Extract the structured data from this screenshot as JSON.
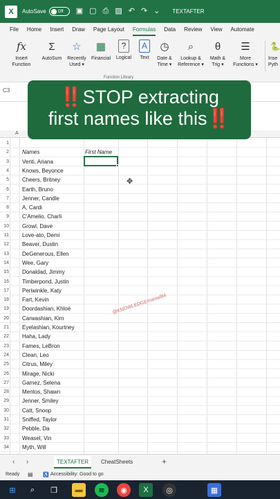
{
  "titlebar": {
    "logo": "X",
    "autosave_label": "AutoSave",
    "toggle_label": "Off",
    "file_title": "TEXTAFTER",
    "icons": [
      "save-icon",
      "page-icon",
      "printer-icon",
      "image-icon",
      "undo-icon",
      "redo-icon",
      "dropdown-icon"
    ]
  },
  "ribbon_tabs": [
    "File",
    "Home",
    "Insert",
    "Draw",
    "Page Layout",
    "Formulas",
    "Data",
    "Review",
    "View",
    "Automate"
  ],
  "active_tab": "Formulas",
  "ribbon": {
    "insert_function": {
      "line1": "Insert",
      "line2": "Function",
      "icon": "fx"
    },
    "autosum": {
      "line1": "AutoSum",
      "line2": "",
      "icon": "Σ"
    },
    "recently_used": {
      "line1": "Recently",
      "line2": "Used ▾",
      "icon": "☆"
    },
    "financial": {
      "line1": "Financial",
      "line2": "",
      "icon": "▦"
    },
    "logical": {
      "line1": "Logical",
      "line2": "",
      "icon": "?"
    },
    "text": {
      "line1": "Text",
      "line2": "",
      "icon": "A"
    },
    "date_time": {
      "line1": "Date &",
      "line2": "Time ▾",
      "icon": "◷"
    },
    "lookup": {
      "line1": "Lookup &",
      "line2": "Reference ▾",
      "icon": "⌕"
    },
    "math": {
      "line1": "Math &",
      "line2": "Trig ▾",
      "icon": "θ"
    },
    "more": {
      "line1": "More",
      "line2": "Functions ▾",
      "icon": "☰"
    },
    "insert_python": {
      "line1": "Inse",
      "line2": "Pyth",
      "icon": "🐍"
    },
    "group_label": "Function Library"
  },
  "formula_bar": {
    "name_box": "C3"
  },
  "banner": {
    "line1_mark": "‼️",
    "line1": "STOP extracting",
    "line2": "first names like this",
    "line2_mark": "‼️"
  },
  "column_header_a": "A",
  "sheet": {
    "header_names": "Names",
    "header_first_name": "First Name",
    "rows": [
      {
        "num": "1",
        "name": ""
      },
      {
        "num": "2",
        "name": ""
      },
      {
        "num": "3",
        "name": "Venti, Ariana"
      },
      {
        "num": "4",
        "name": "Knows, Beyonce"
      },
      {
        "num": "5",
        "name": "Cheers, Britney"
      },
      {
        "num": "6",
        "name": "Earth, Bruno"
      },
      {
        "num": "7",
        "name": "Jenner, Candle"
      },
      {
        "num": "8",
        "name": "A, Cardi"
      },
      {
        "num": "9",
        "name": "C'Amelio, Charli"
      },
      {
        "num": "10",
        "name": "Growl, Dave"
      },
      {
        "num": "11",
        "name": "Love-ato, Demi"
      },
      {
        "num": "12",
        "name": "Beaver, Dustin"
      },
      {
        "num": "13",
        "name": "DeGenerous, Ellen"
      },
      {
        "num": "14",
        "name": "Wee, Gary"
      },
      {
        "num": "15",
        "name": "Donaldad, Jimmy"
      },
      {
        "num": "16",
        "name": "Timberpond, Justin"
      },
      {
        "num": "17",
        "name": "Periwinkle, Katy"
      },
      {
        "num": "18",
        "name": "Fart, Kevin"
      },
      {
        "num": "19",
        "name": "Doordashian, Khloé"
      },
      {
        "num": "20",
        "name": "Carwashian, Kim"
      },
      {
        "num": "21",
        "name": "Eyelashian, Kourtney"
      },
      {
        "num": "22",
        "name": "Haha, Lady"
      },
      {
        "num": "23",
        "name": "Fames, LeBron"
      },
      {
        "num": "24",
        "name": "Clean, Leo"
      },
      {
        "num": "25",
        "name": "Citrus, Miley"
      },
      {
        "num": "26",
        "name": "Mirage, Nicki"
      },
      {
        "num": "27",
        "name": "Gamez, Selena"
      },
      {
        "num": "28",
        "name": "Mentos, Shawn"
      },
      {
        "num": "29",
        "name": "Jenner, Smiley"
      },
      {
        "num": "30",
        "name": "Catt, Snoop"
      },
      {
        "num": "31",
        "name": "Sniffed, Taylor"
      },
      {
        "num": "32",
        "name": "Pebble, Da"
      },
      {
        "num": "33",
        "name": "Weasel, Vin"
      },
      {
        "num": "34",
        "name": "Myth, Will"
      }
    ]
  },
  "watermark": "@KNOWLEDGEmania9t4",
  "sheet_tabs": {
    "prev": "‹",
    "next": "›",
    "tab1": "TEXTAFTER",
    "tab2": "CheatSheets",
    "add": "+"
  },
  "status": {
    "ready": "Ready",
    "accessibility": "Accessibility: Good to go"
  },
  "taskbar_icons": [
    "windows-icon",
    "search-icon",
    "task-view-icon",
    "file-explorer-icon",
    "spotify-icon",
    "chrome-icon",
    "excel-icon",
    "obs-icon",
    "calculator-icon"
  ],
  "colors": {
    "excel_green": "#217346",
    "banner_green": "#1f6b3d",
    "taskbar": "#1a2330",
    "alert_red": "#e53935"
  }
}
